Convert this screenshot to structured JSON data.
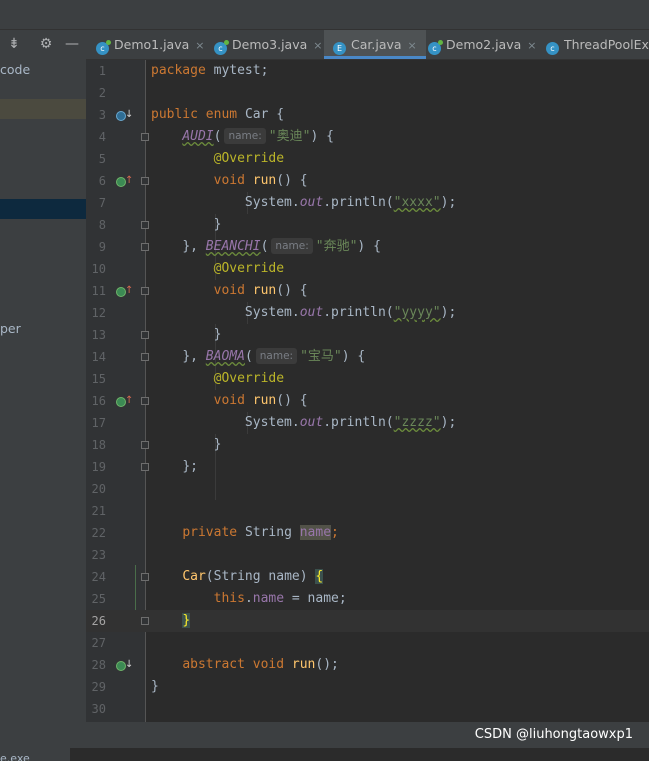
{
  "sidebar": {
    "tools": [
      {
        "icon": "collapse-all-icon"
      },
      {
        "icon": "gear-icon"
      },
      {
        "icon": "minimize-icon"
      }
    ],
    "rows": [
      {
        "label": "code"
      },
      {
        "label": ""
      },
      {
        "label": ""
      },
      {
        "label": "per"
      }
    ]
  },
  "tabs": [
    {
      "label": "Demo1.java",
      "icon": "class-icon",
      "active": false
    },
    {
      "label": "Demo3.java",
      "icon": "class-icon",
      "active": false
    },
    {
      "label": "Car.java",
      "icon": "enum-icon",
      "active": true
    },
    {
      "label": "Demo2.java",
      "icon": "class-icon",
      "active": false
    },
    {
      "label": "ThreadPoolExe",
      "icon": "class-icon",
      "active": false
    }
  ],
  "tab_icon_letters": {
    "class": "c",
    "enum": "E"
  },
  "tab_close_glyph": "×",
  "code": {
    "lines": [
      "1",
      "2",
      "3",
      "4",
      "5",
      "6",
      "7",
      "8",
      "9",
      "10",
      "11",
      "12",
      "13",
      "14",
      "15",
      "16",
      "17",
      "18",
      "19",
      "20",
      "21",
      "22",
      "23",
      "24",
      "25",
      "26",
      "27",
      "28",
      "29",
      "30"
    ],
    "current_line": "26",
    "package_kw": "package",
    "package_name": "mytest;",
    "public_kw": "public",
    "enum_kw": "enum",
    "class_name": "Car",
    "open_brace": "{",
    "close_brace": "}",
    "enum_constants": [
      {
        "name": "AUDI",
        "hint": "name:",
        "arg": "\"奥迪\"",
        "println_arg": "\"xxxx\""
      },
      {
        "name": "BEANCHI",
        "hint": "name:",
        "arg": "\"奔驰\"",
        "println_arg": "\"yyyy\""
      },
      {
        "name": "BAOMA",
        "hint": "name:",
        "arg": "\"宝马\"",
        "println_arg": "\"zzzz\""
      }
    ],
    "override": "@Override",
    "void_kw": "void",
    "run_method": "run",
    "system": "System.",
    "out_field": "out",
    "println_call": ".println(",
    "close_call": ");",
    "private_kw": "private",
    "string_type": "String",
    "field_name": "name",
    "semicolon": ";",
    "constructor_sig": "(String name) ",
    "this_kw": "this",
    "assign_rest": " = name;",
    "abstract_kw": "abstract",
    "abstract_tail": "();"
  },
  "status": {
    "watermark": "CSDN @liuhongtaowxp1"
  },
  "bottom": {
    "label": "e.exe"
  },
  "colors": {
    "keyword": "#cc7832",
    "string": "#6a8759",
    "annotation": "#bbb529",
    "field": "#9876aa",
    "method": "#ffc66d",
    "default_text": "#a9b7c6",
    "background": "#2b2b2b",
    "accent": "#4a88c7"
  }
}
